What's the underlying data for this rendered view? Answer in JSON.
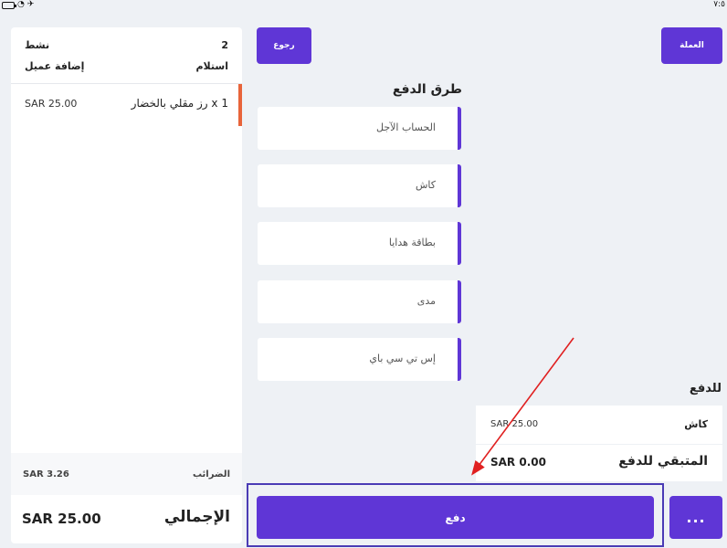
{
  "status_bar": {
    "time": "٧:٥"
  },
  "order": {
    "count": "2",
    "state": "نشط",
    "receive": "استلام",
    "add_customer": "إضافة عميل",
    "items": [
      {
        "name": "1  x  رز مقلي بالخضار",
        "price": "SAR 25.00"
      }
    ],
    "tax_label": "الضرائب",
    "tax_value": "SAR 3.26",
    "total_label": "الإجمالي",
    "total_value": "SAR 25.00"
  },
  "toolbar": {
    "back_label": "رجوع",
    "currency_label": "العملة"
  },
  "payment_methods": {
    "title": "طرق الدفع",
    "items": [
      "الحساب الآجل",
      "كاش",
      "بطاقة هدايا",
      "مدى",
      "إس تي سي باي"
    ]
  },
  "payment_summary": {
    "title": "للدفع",
    "method_label": "كاش",
    "method_amount": "SAR 25.00",
    "remaining_label": "المتبقي للدفع",
    "remaining_amount": "SAR 0.00"
  },
  "actions": {
    "pay_label": "دفع",
    "more_label": "..."
  },
  "colors": {
    "accent": "#5f36d6",
    "line_marker": "#e8643a",
    "arrow": "#e02020",
    "highlight": "#4a3bb5"
  }
}
